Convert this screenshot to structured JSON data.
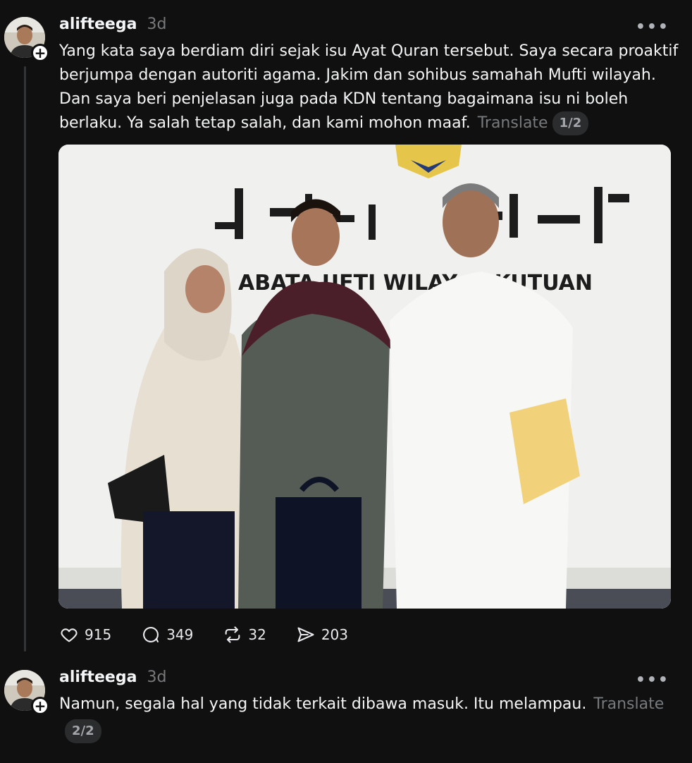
{
  "post1": {
    "username": "alifteega",
    "time": "3d",
    "more_label": "•••",
    "text": "Yang kata saya berdiam diri sejak isu Ayat Quran tersebut. Saya secara proaktif berjumpa dengan autoriti agama. Jakim dan sohibus samahah Mufti wilayah. Dan saya beri penjelasan juga pada KDN tentang bagaimana isu ni boleh berlaku. Ya salah tetap salah, dan kami mohon maaf.",
    "translate_label": "Translate",
    "pager": "1/2",
    "photo": {
      "wall_text_latin": "ABATA   UFTI WILAY   SEKUTUAN"
    },
    "actions": {
      "likes": "915",
      "replies": "349",
      "reposts": "32",
      "shares": "203"
    }
  },
  "post2": {
    "username": "alifteega",
    "time": "3d",
    "more_label": "•••",
    "text": "Namun, segala hal yang tidak terkait dibawa masuk. Itu melampau.",
    "translate_label": "Translate",
    "pager": "2/2"
  },
  "colors": {
    "background": "#101010",
    "text": "#f3f5f7",
    "secondary": "#777a7d",
    "thread_line": "#333638"
  },
  "icons": [
    "plus-icon",
    "more-icon",
    "heart-icon",
    "comment-icon",
    "repost-icon",
    "share-icon"
  ]
}
